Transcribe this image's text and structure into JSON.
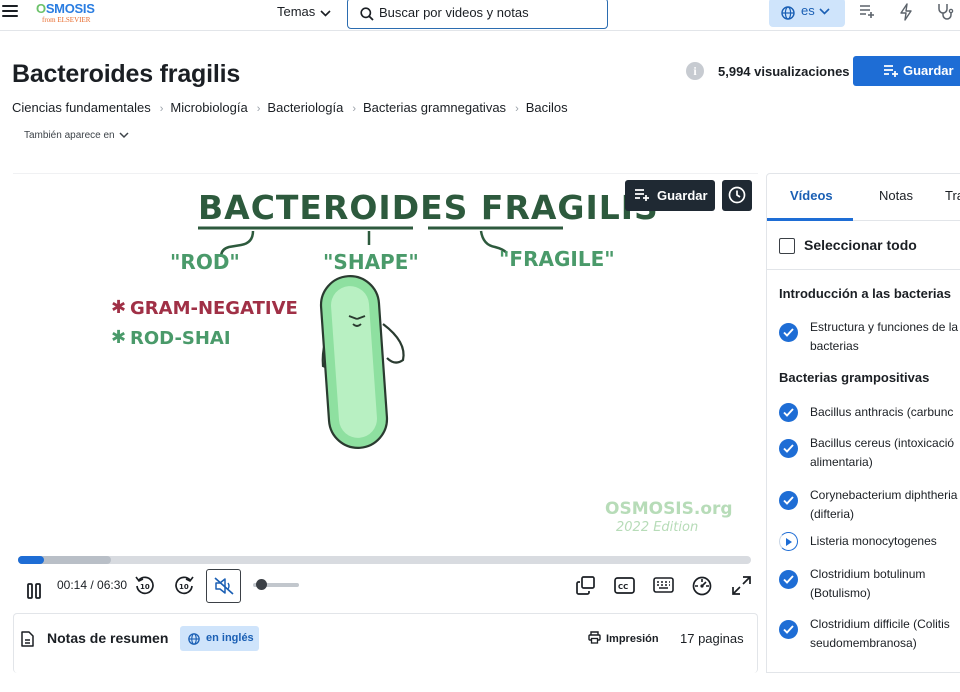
{
  "brand": {
    "name_prefix": "O",
    "name": "SMOSIS",
    "tagline": "from ELSEVIER"
  },
  "topbar": {
    "menu_label": "Temas",
    "search_placeholder": "Buscar por videos y notas",
    "language": "es"
  },
  "page": {
    "title": "Bacteroides fragilis",
    "views": "5,994 visualizaciones",
    "save_label": "Guardar",
    "also_appears": "También aparece en"
  },
  "breadcrumb": [
    "Ciencias fundamentales",
    "Microbiología",
    "Bacteriología",
    "Bacterias gramnegativas",
    "Bacilos"
  ],
  "video": {
    "save_label": "Guardar",
    "title_art": "BACTEROIDES FRAGILIS",
    "labels": {
      "rod": "\"ROD\"",
      "shape": "\"SHAPE\"",
      "fragile": "\"FRAGILE\""
    },
    "bullets": [
      "GRAM-NEGATIVE",
      "ROD-SHAI"
    ],
    "watermark": "OSMOSIS.org",
    "watermark_edition": "2022 Edition",
    "current_time": "00:14",
    "duration": "06:30",
    "progress_fraction": 0.036,
    "buffered_fraction": 0.127,
    "volume_fraction": 0.1,
    "skip_back_label": "10",
    "skip_fwd_label": "10",
    "cc_label": "CC"
  },
  "notes": {
    "title": "Notas de resumen",
    "language_badge": "en inglés",
    "print_label": "Impresión",
    "pages": "17 paginas"
  },
  "panel": {
    "tabs": [
      "Vídeos",
      "Notas",
      "Tra"
    ],
    "select_all": "Seleccionar todo",
    "sections": [
      {
        "heading": "Introducción a las bacterias",
        "items": [
          {
            "lines": [
              "Estructura y funciones de la",
              "bacterias"
            ],
            "status": "done"
          }
        ]
      },
      {
        "heading": "Bacterias grampositivas",
        "items": [
          {
            "lines": [
              "Bacillus anthracis (carbunc"
            ],
            "status": "done"
          },
          {
            "lines": [
              "Bacillus cereus (intoxicació",
              "alimentaria)"
            ],
            "status": "done"
          },
          {
            "lines": [
              "Corynebacterium diphtheria",
              "(difteria)"
            ],
            "status": "done"
          },
          {
            "lines": [
              "Listeria monocytogenes"
            ],
            "status": "partial"
          },
          {
            "lines": [
              "Clostridium botulinum",
              "(Botulismo)"
            ],
            "status": "done"
          },
          {
            "lines": [
              "Clostridium difficile (Colitis",
              "seudomembranosa)"
            ],
            "status": "done"
          }
        ]
      }
    ]
  },
  "colors": {
    "accent": "#1e6dd5",
    "dark": "#1f2933",
    "badge_bg": "#cfe4fb",
    "title_green": "#2d5a3d",
    "label_green": "#4a9a6a",
    "bullet_red": "#a03046"
  }
}
